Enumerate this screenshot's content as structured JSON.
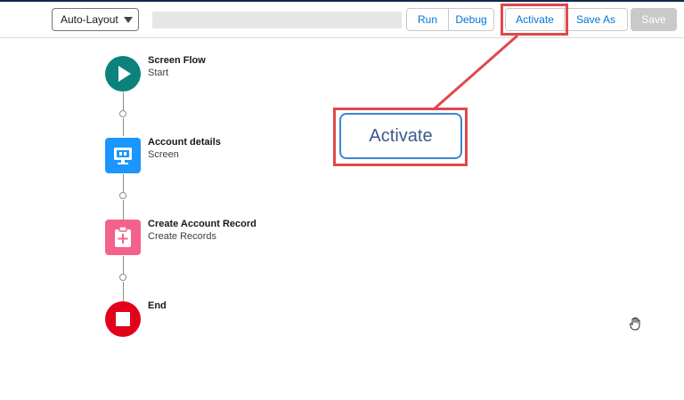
{
  "toolbar": {
    "layout_select": "Auto-Layout",
    "buttons": {
      "run": "Run",
      "debug": "Debug",
      "activate": "Activate",
      "save_as": "Save As",
      "save": "Save"
    }
  },
  "callout": {
    "label": "Activate"
  },
  "flow": {
    "nodes": [
      {
        "title": "Screen Flow",
        "subtitle": "Start",
        "icon": "play-icon",
        "color": "#0b827c"
      },
      {
        "title": "Account details",
        "subtitle": "Screen",
        "icon": "screen-icon",
        "color": "#1b96ff"
      },
      {
        "title": "Create Account Record",
        "subtitle": "Create Records",
        "icon": "create-records-icon",
        "color": "#f4628c"
      },
      {
        "title": "End",
        "subtitle": "",
        "icon": "stop-icon",
        "color": "#e3001b"
      }
    ]
  },
  "colors": {
    "highlight": "#e0484c",
    "brand_blue": "#0176d3"
  }
}
